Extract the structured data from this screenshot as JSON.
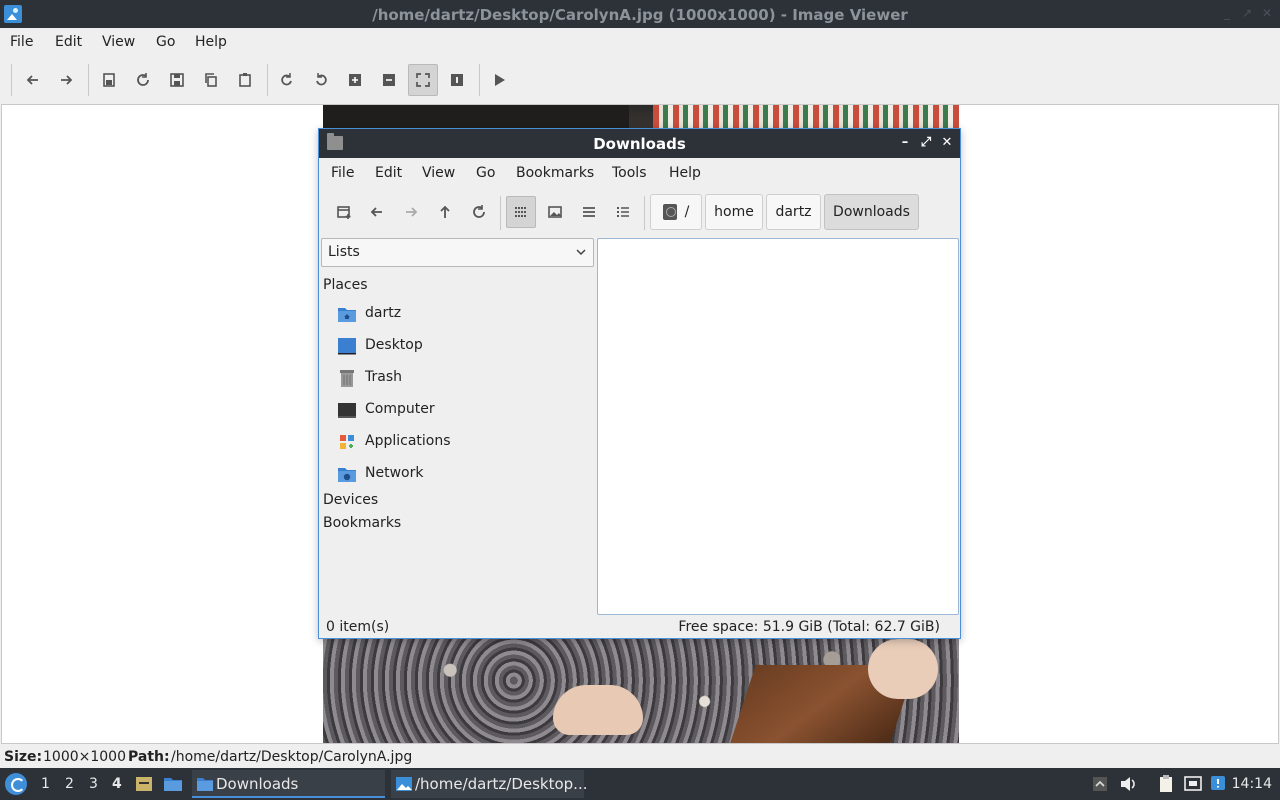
{
  "viewer": {
    "title": "/home/dartz/Desktop/CarolynA.jpg (1000x1000) - Image Viewer",
    "menu": [
      "File",
      "Edit",
      "View",
      "Go",
      "Help"
    ],
    "status": {
      "size_label": "Size:",
      "size_value": "1000×1000",
      "path_label": "Path:",
      "path_value": "/home/dartz/Desktop/CarolynA.jpg"
    }
  },
  "filemanager": {
    "title": "Downloads",
    "menu": [
      "File",
      "Edit",
      "View",
      "Go",
      "Bookmarks",
      "Tools",
      "Help"
    ],
    "breadcrumbs": [
      "/",
      "home",
      "dartz",
      "Downloads"
    ],
    "sidebar_mode": "Lists",
    "places_heading": "Places",
    "places": [
      "dartz",
      "Desktop",
      "Trash",
      "Computer",
      "Applications",
      "Network"
    ],
    "devices_heading": "Devices",
    "bookmarks_heading": "Bookmarks",
    "status_items": "0 item(s)",
    "status_space": "Free space: 51.9 GiB (Total: 62.7 GiB)"
  },
  "taskbar": {
    "workspaces": [
      "1",
      "2",
      "3",
      "4"
    ],
    "active_workspace": "4",
    "tasks": [
      "Downloads",
      "/home/dartz/Desktop..."
    ],
    "clock": "14:14"
  },
  "colors": {
    "titlebar": "#2d3239",
    "accent": "#4a90d9",
    "folder_blue": "#3b7fd0"
  }
}
